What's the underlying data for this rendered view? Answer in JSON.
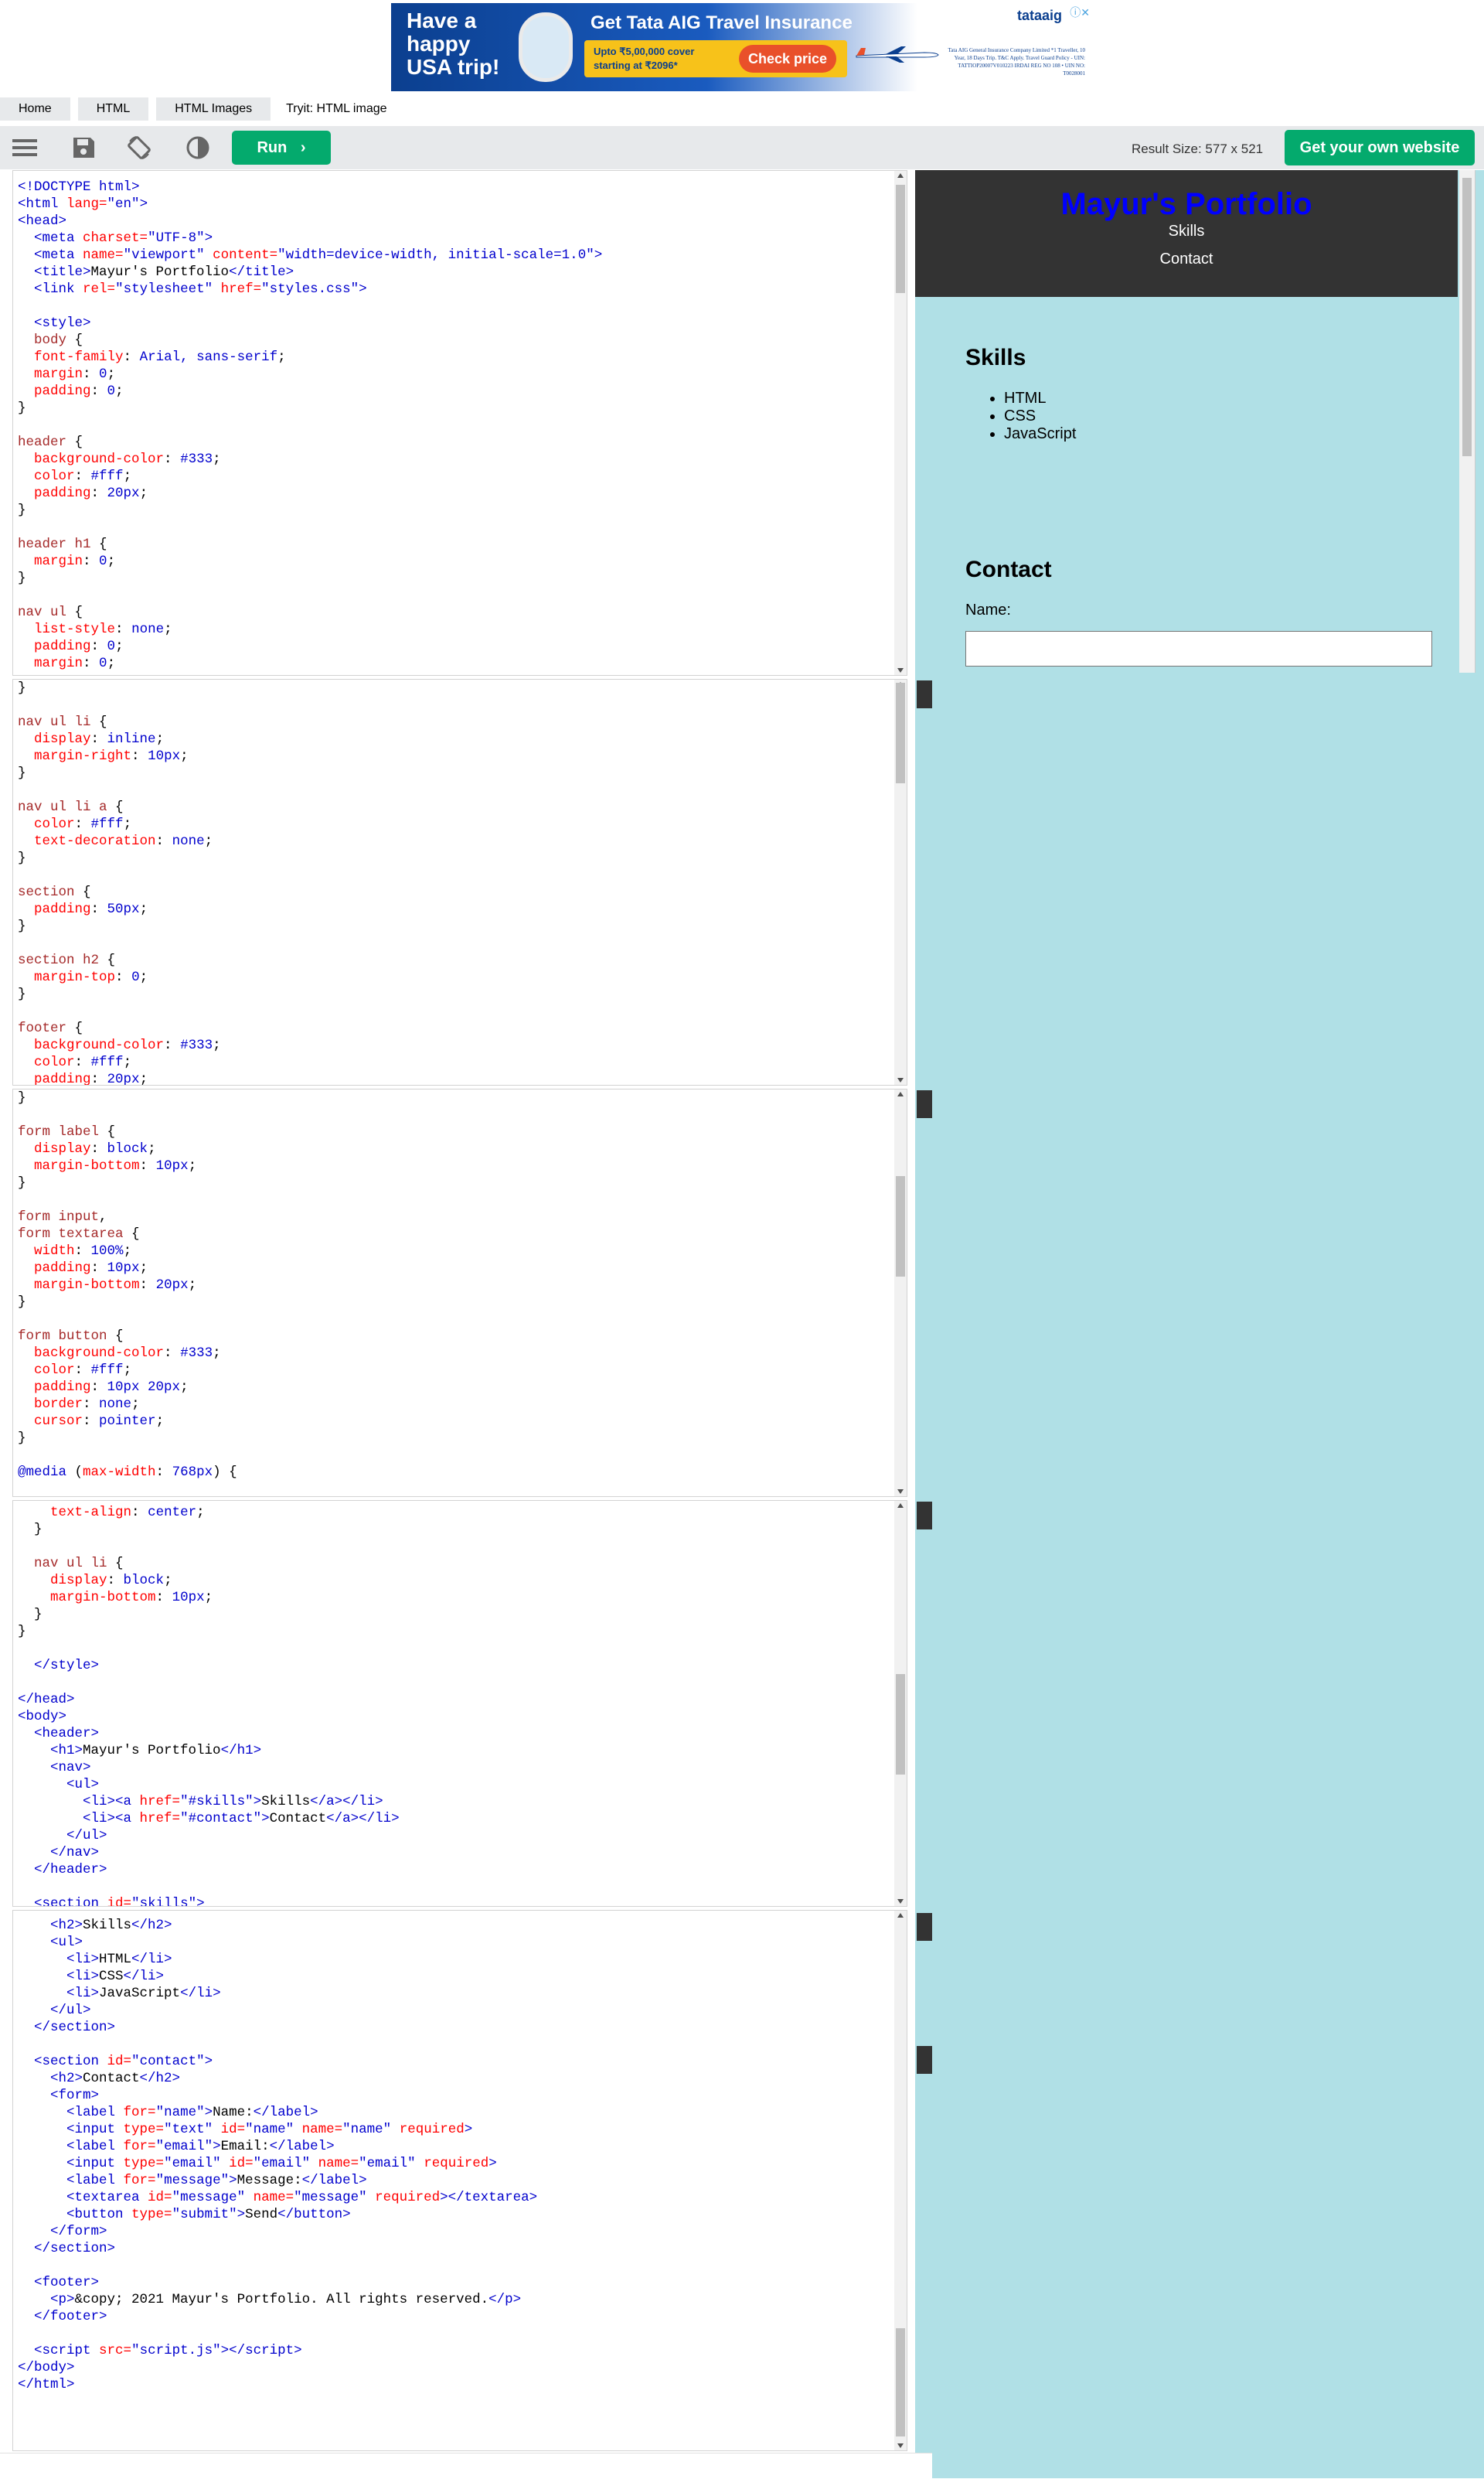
{
  "ad": {
    "headline": "Have a happy USA trip!",
    "title": "Get Tata AIG Travel Insurance",
    "cover_line1": "Upto ₹5,00,000 cover",
    "cover_line2": "starting at ₹2096*",
    "cta": "Check price",
    "brand": "tataaig",
    "fine_print": "Tata AIG General Insurance Company Limited *1 Traveller, 10 Year, 18 Days Trip. T&C Apply. Travel Guard Policy - UIN: TATTIOP20007V010223 IRDAI REG NO 108 • UIN NO: T0028001"
  },
  "breadcrumb": {
    "items": [
      "Home",
      "HTML",
      "HTML Images"
    ],
    "current": "Tryit: HTML image"
  },
  "toolbar": {
    "run_label": "Run",
    "result_size": "Result Size: 577 x 521",
    "own_website_label": "Get your own website"
  },
  "result": {
    "title": "Mayur's Portfolio",
    "nav": [
      "Skills",
      "Contact"
    ],
    "skills_heading": "Skills",
    "skills": [
      "HTML",
      "CSS",
      "JavaScript"
    ],
    "contact_heading": "Contact",
    "name_label": "Name:"
  }
}
